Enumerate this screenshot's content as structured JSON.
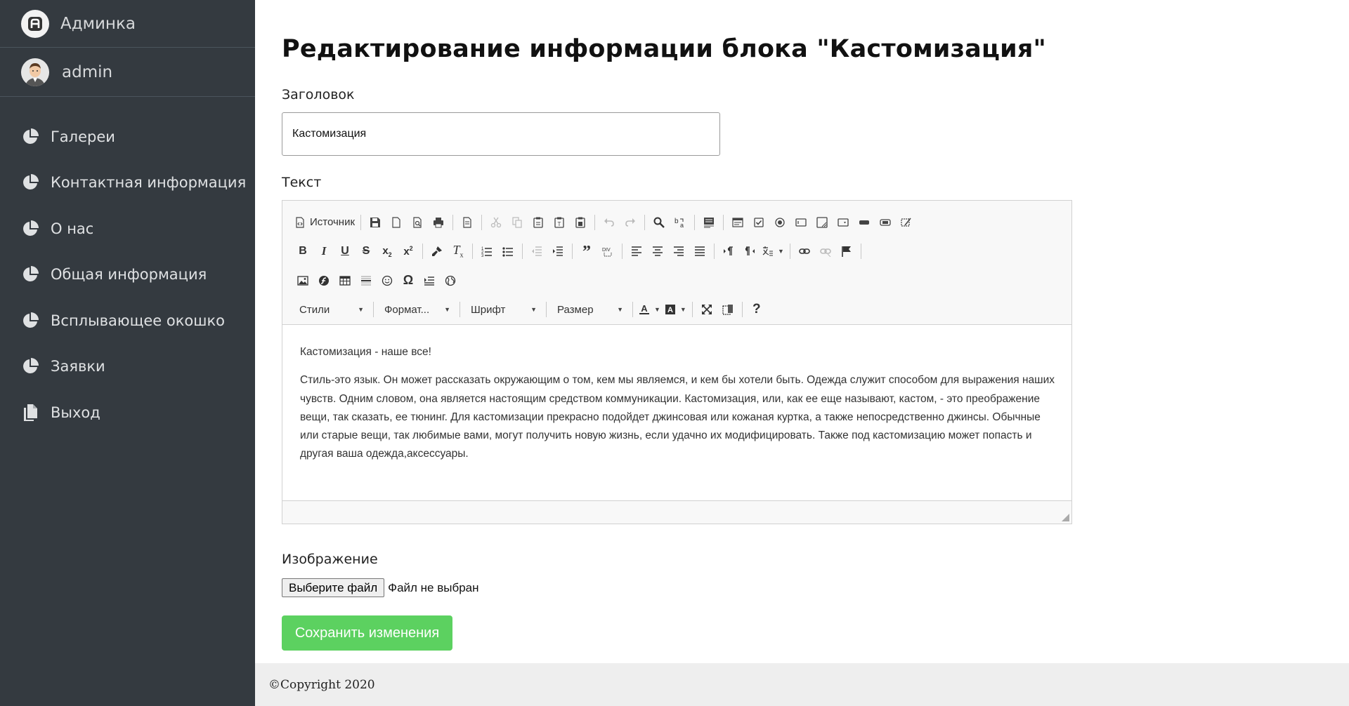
{
  "sidebar": {
    "brand": "Админка",
    "user": "admin",
    "items": [
      {
        "label": "Галереи",
        "icon": "pie-chart-icon"
      },
      {
        "label": "Контактная информация",
        "icon": "pie-chart-icon"
      },
      {
        "label": "О нас",
        "icon": "pie-chart-icon"
      },
      {
        "label": "Общая информация",
        "icon": "pie-chart-icon"
      },
      {
        "label": "Всплывающее окошко",
        "icon": "pie-chart-icon"
      },
      {
        "label": "Заявки",
        "icon": "pie-chart-icon"
      },
      {
        "label": "Выход",
        "icon": "copy-icon"
      }
    ]
  },
  "page": {
    "title": "Редактирование информации блока \"Кастомизация\"",
    "title_label": "Заголовок",
    "title_value": "Кастомизация",
    "text_label": "Текст",
    "image_label": "Изображение",
    "file_button": "Выберите файл",
    "file_status": "Файл не выбран",
    "save_button": "Сохранить изменения"
  },
  "editor": {
    "source_label": "Источник",
    "combos": {
      "styles": "Стили",
      "format": "Формат...",
      "font": "Шрифт",
      "size": "Размер"
    },
    "paragraphs": [
      "Кастомизация - наше все!",
      "Стиль-это язык. Он может рассказать окружающим о том, кем мы являемся, и кем бы хотели быть. Одежда служит способом для выражения наших чувств. Одним словом, она является настоящим средством коммуникации. Кастомизация, или, как ее еще называют, кастом, - это преображение вещи, так сказать, ее тюнинг. Для кастомизации прекрасно подойдет джинсовая или кожаная куртка, а также непосредственно джинсы. Обычные или старые вещи, так любимые вами, могут получить новую жизнь, если удачно их модифицировать. Также под кастомизацию может попасть и другая ваша одежда,аксессуары."
    ]
  },
  "footer": {
    "copyright": "©Copyright 2020"
  },
  "colors": {
    "sidebar_bg": "#343a40",
    "save_button": "#5cd160",
    "footer_bg": "#eeeeee"
  }
}
